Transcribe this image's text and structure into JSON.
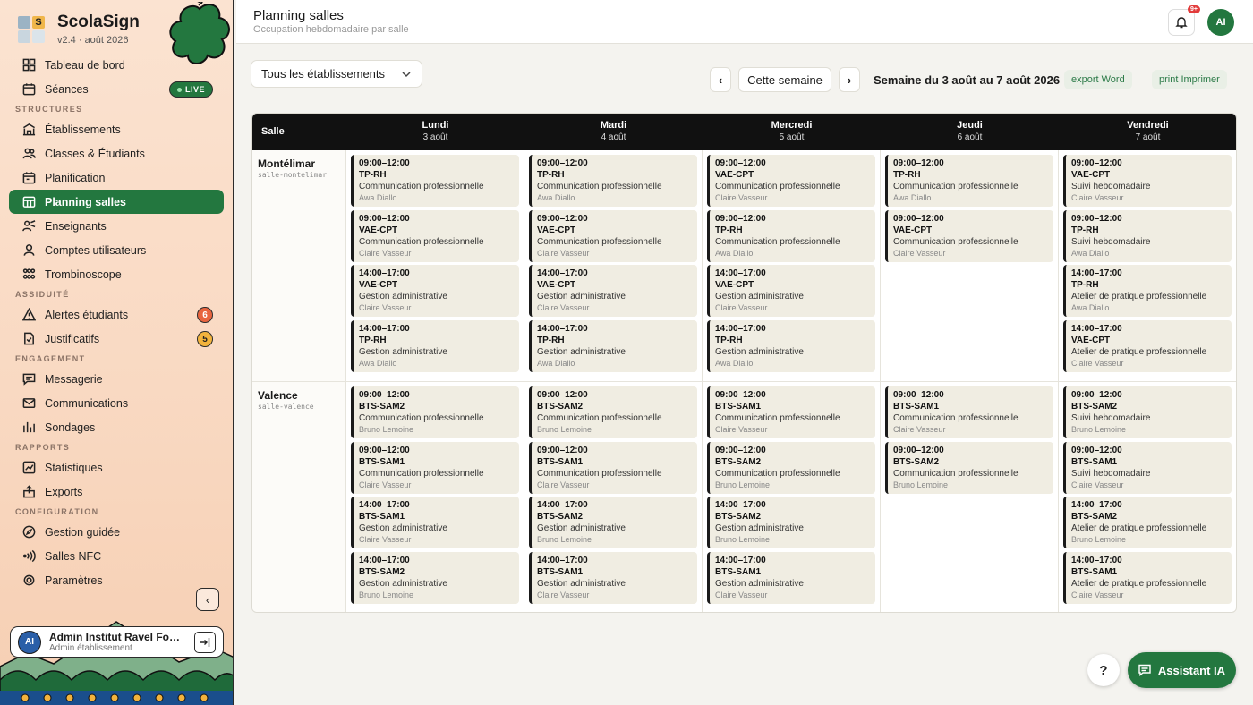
{
  "brand": {
    "logo_letter": "S",
    "name": "ScolaSign",
    "version": "v2.4 · août 2026"
  },
  "nav": {
    "tableau": "Tableau de bord",
    "seances": "Séances",
    "live": "LIVE",
    "sec_structures": "STRUCTURES",
    "etablissements": "Établissements",
    "classes": "Classes & Étudiants",
    "planification": "Planification",
    "planning_salles": "Planning salles",
    "enseignants": "Enseignants",
    "comptes": "Comptes utilisateurs",
    "trombinoscope": "Trombinoscope",
    "sec_assiduite": "ASSIDUITÉ",
    "alertes": "Alertes étudiants",
    "alertes_count": "6",
    "justificatifs": "Justificatifs",
    "justificatifs_count": "5",
    "sec_engagement": "ENGAGEMENT",
    "messagerie": "Messagerie",
    "communications": "Communications",
    "sondages": "Sondages",
    "sec_rapports": "RAPPORTS",
    "statistiques": "Statistiques",
    "exports": "Exports",
    "sec_configuration": "CONFIGURATION",
    "gestion_guidee": "Gestion guidée",
    "salles_nfc": "Salles NFC",
    "parametres": "Paramètres"
  },
  "user": {
    "initials": "AI",
    "name": "Admin Institut Ravel Formation",
    "role": "Admin établissement"
  },
  "header": {
    "title": "Planning salles",
    "subtitle": "Occupation hebdomadaire par salle",
    "notif_count": "9+",
    "avatar": "AI"
  },
  "toolbar": {
    "select_value": "Tous les établissements",
    "prev": "‹",
    "this_week": "Cette semaine",
    "next": "›",
    "week_label": "Semaine du 3 août au 7 août 2026",
    "export": "export  Word",
    "print": "print  Imprimer"
  },
  "grid": {
    "salle_header": "Salle",
    "days": [
      {
        "name": "Lundi",
        "date": "3 août"
      },
      {
        "name": "Mardi",
        "date": "4 août"
      },
      {
        "name": "Mercredi",
        "date": "5 août"
      },
      {
        "name": "Jeudi",
        "date": "6 août"
      },
      {
        "name": "Vendredi",
        "date": "7 août"
      }
    ],
    "rooms": [
      {
        "name": "Montélimar",
        "id": "salle-montelimar",
        "days": [
          [
            {
              "time": "09:00–12:00",
              "class": "TP-RH",
              "subject": "Communication professionnelle",
              "teacher": "Awa Diallo"
            },
            {
              "time": "09:00–12:00",
              "class": "VAE-CPT",
              "subject": "Communication professionnelle",
              "teacher": "Claire Vasseur"
            },
            {
              "time": "14:00–17:00",
              "class": "VAE-CPT",
              "subject": "Gestion administrative",
              "teacher": "Claire Vasseur"
            },
            {
              "time": "14:00–17:00",
              "class": "TP-RH",
              "subject": "Gestion administrative",
              "teacher": "Awa Diallo"
            }
          ],
          [
            {
              "time": "09:00–12:00",
              "class": "TP-RH",
              "subject": "Communication professionnelle",
              "teacher": "Awa Diallo"
            },
            {
              "time": "09:00–12:00",
              "class": "VAE-CPT",
              "subject": "Communication professionnelle",
              "teacher": "Claire Vasseur"
            },
            {
              "time": "14:00–17:00",
              "class": "VAE-CPT",
              "subject": "Gestion administrative",
              "teacher": "Claire Vasseur"
            },
            {
              "time": "14:00–17:00",
              "class": "TP-RH",
              "subject": "Gestion administrative",
              "teacher": "Awa Diallo"
            }
          ],
          [
            {
              "time": "09:00–12:00",
              "class": "VAE-CPT",
              "subject": "Communication professionnelle",
              "teacher": "Claire Vasseur"
            },
            {
              "time": "09:00–12:00",
              "class": "TP-RH",
              "subject": "Communication professionnelle",
              "teacher": "Awa Diallo"
            },
            {
              "time": "14:00–17:00",
              "class": "VAE-CPT",
              "subject": "Gestion administrative",
              "teacher": "Claire Vasseur"
            },
            {
              "time": "14:00–17:00",
              "class": "TP-RH",
              "subject": "Gestion administrative",
              "teacher": "Awa Diallo"
            }
          ],
          [
            {
              "time": "09:00–12:00",
              "class": "TP-RH",
              "subject": "Communication professionnelle",
              "teacher": "Awa Diallo"
            },
            {
              "time": "09:00–12:00",
              "class": "VAE-CPT",
              "subject": "Communication professionnelle",
              "teacher": "Claire Vasseur"
            }
          ],
          [
            {
              "time": "09:00–12:00",
              "class": "VAE-CPT",
              "subject": "Suivi hebdomadaire",
              "teacher": "Claire Vasseur"
            },
            {
              "time": "09:00–12:00",
              "class": "TP-RH",
              "subject": "Suivi hebdomadaire",
              "teacher": "Awa Diallo"
            },
            {
              "time": "14:00–17:00",
              "class": "TP-RH",
              "subject": "Atelier de pratique professionnelle",
              "teacher": "Awa Diallo"
            },
            {
              "time": "14:00–17:00",
              "class": "VAE-CPT",
              "subject": "Atelier de pratique professionnelle",
              "teacher": "Claire Vasseur"
            }
          ]
        ]
      },
      {
        "name": "Valence",
        "id": "salle-valence",
        "days": [
          [
            {
              "time": "09:00–12:00",
              "class": "BTS-SAM2",
              "subject": "Communication professionnelle",
              "teacher": "Bruno Lemoine"
            },
            {
              "time": "09:00–12:00",
              "class": "BTS-SAM1",
              "subject": "Communication professionnelle",
              "teacher": "Claire Vasseur"
            },
            {
              "time": "14:00–17:00",
              "class": "BTS-SAM1",
              "subject": "Gestion administrative",
              "teacher": "Claire Vasseur"
            },
            {
              "time": "14:00–17:00",
              "class": "BTS-SAM2",
              "subject": "Gestion administrative",
              "teacher": "Bruno Lemoine"
            }
          ],
          [
            {
              "time": "09:00–12:00",
              "class": "BTS-SAM2",
              "subject": "Communication professionnelle",
              "teacher": "Bruno Lemoine"
            },
            {
              "time": "09:00–12:00",
              "class": "BTS-SAM1",
              "subject": "Communication professionnelle",
              "teacher": "Claire Vasseur"
            },
            {
              "time": "14:00–17:00",
              "class": "BTS-SAM2",
              "subject": "Gestion administrative",
              "teacher": "Bruno Lemoine"
            },
            {
              "time": "14:00–17:00",
              "class": "BTS-SAM1",
              "subject": "Gestion administrative",
              "teacher": "Claire Vasseur"
            }
          ],
          [
            {
              "time": "09:00–12:00",
              "class": "BTS-SAM1",
              "subject": "Communication professionnelle",
              "teacher": "Claire Vasseur"
            },
            {
              "time": "09:00–12:00",
              "class": "BTS-SAM2",
              "subject": "Communication professionnelle",
              "teacher": "Bruno Lemoine"
            },
            {
              "time": "14:00–17:00",
              "class": "BTS-SAM2",
              "subject": "Gestion administrative",
              "teacher": "Bruno Lemoine"
            },
            {
              "time": "14:00–17:00",
              "class": "BTS-SAM1",
              "subject": "Gestion administrative",
              "teacher": "Claire Vasseur"
            }
          ],
          [
            {
              "time": "09:00–12:00",
              "class": "BTS-SAM1",
              "subject": "Communication professionnelle",
              "teacher": "Claire Vasseur"
            },
            {
              "time": "09:00–12:00",
              "class": "BTS-SAM2",
              "subject": "Communication professionnelle",
              "teacher": "Bruno Lemoine"
            }
          ],
          [
            {
              "time": "09:00–12:00",
              "class": "BTS-SAM2",
              "subject": "Suivi hebdomadaire",
              "teacher": "Bruno Lemoine"
            },
            {
              "time": "09:00–12:00",
              "class": "BTS-SAM1",
              "subject": "Suivi hebdomadaire",
              "teacher": "Claire Vasseur"
            },
            {
              "time": "14:00–17:00",
              "class": "BTS-SAM2",
              "subject": "Atelier de pratique professionnelle",
              "teacher": "Bruno Lemoine"
            },
            {
              "time": "14:00–17:00",
              "class": "BTS-SAM1",
              "subject": "Atelier de pratique professionnelle",
              "teacher": "Claire Vasseur"
            }
          ]
        ]
      }
    ]
  },
  "floating": {
    "help": "?",
    "assistant": "Assistant IA"
  },
  "colors": {
    "accent": "#23773f",
    "badge_red": "#e8653f",
    "badge_orange": "#f2b33d",
    "header_black": "#111111",
    "card_bg": "#f0ede2"
  }
}
